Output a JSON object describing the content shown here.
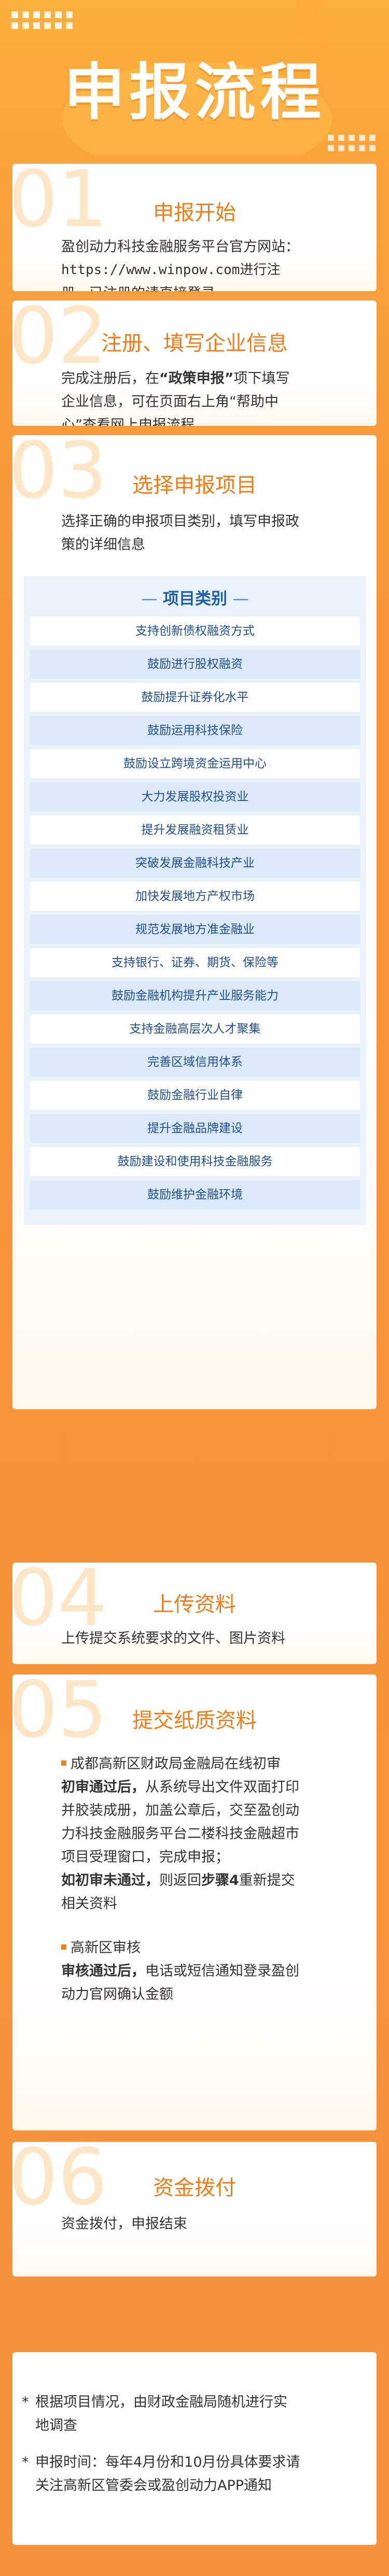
{
  "header": {
    "title": "申报流程"
  },
  "steps": [
    {
      "num": "01",
      "title": "申报开始",
      "lines": [
        "盈创动力科技金融服务平台官方网站：",
        "https://www.winpow.com进行注",
        "册，已注册的请直接登录"
      ]
    },
    {
      "num": "02",
      "title": "注册、填写企业信息",
      "line1_a": "完成注册后，在",
      "line1_b": "“政策申报”",
      "line1_c": "项下填写",
      "line2": "企业信息，可在页面右上角“帮助中",
      "line3": "心”查看网上申报流程"
    },
    {
      "num": "03",
      "title": "选择申报项目",
      "lines": [
        "选择正确的申报项目类别，填写申报政",
        "策的详细信息"
      ],
      "types_title": "项目类别",
      "types_dash_left": "—",
      "types_dash_right": "—",
      "types": [
        "支持创新债权融资方式",
        "鼓励进行股权融资",
        "鼓励提升证券化水平",
        "鼓励运用科技保险",
        "鼓励设立跨境资金运用中心",
        "大力发展股权投资业",
        "提升发展融资租赁业",
        "突破发展金融科技产业",
        "加快发展地方产权市场",
        "规范发展地方准金融业",
        "支持银行、证券、期货、保险等",
        "鼓励金融机构提升产业服务能力",
        "支持金融高层次人才聚集",
        "完善区域信用体系",
        "鼓励金融行业自律",
        "提升金融品牌建设",
        "鼓励建设和使用科技金融服务",
        "鼓励维护金融环境"
      ]
    },
    {
      "num": "04",
      "title": "上传资料",
      "lines": [
        "上传提交系统要求的文件、图片资料"
      ]
    },
    {
      "num": "05",
      "title": "提交纸质资料",
      "s1_head": "成都高新区财政局金融局在线初审",
      "s1_l2_a": "初审通过后，",
      "s1_l2_b": "从系统导出文件双面打印",
      "s1_l3": "并胶装成册，加盖公章后，交至盈创动",
      "s1_l4": "力科技金融服务平台二楼科技金融超市",
      "s1_l5": "项目受理窗口，完成申报；",
      "s1_l6_a": "如初审未通过，",
      "s1_l6_b": "则返回",
      "s1_l6_c": "步骤4",
      "s1_l6_d": "重新提交",
      "s1_l7": "相关资料",
      "s2_head": "高新区审核",
      "s2_l2_a": "审核通过后，",
      "s2_l2_b": "电话或短信通知登录盈创",
      "s2_l3": "动力官网确认金额"
    },
    {
      "num": "06",
      "title": "资金拨付",
      "lines": [
        "资金拨付，申报结束"
      ]
    }
  ],
  "footer": {
    "star": "*",
    "item1": [
      "根据项目情况，由财政金融局随机进行实",
      "地调查"
    ],
    "item2": [
      "申报时间：每年4月份和10月份具体要求请",
      "关注高新区管委会或盈创动力APP通知"
    ]
  }
}
